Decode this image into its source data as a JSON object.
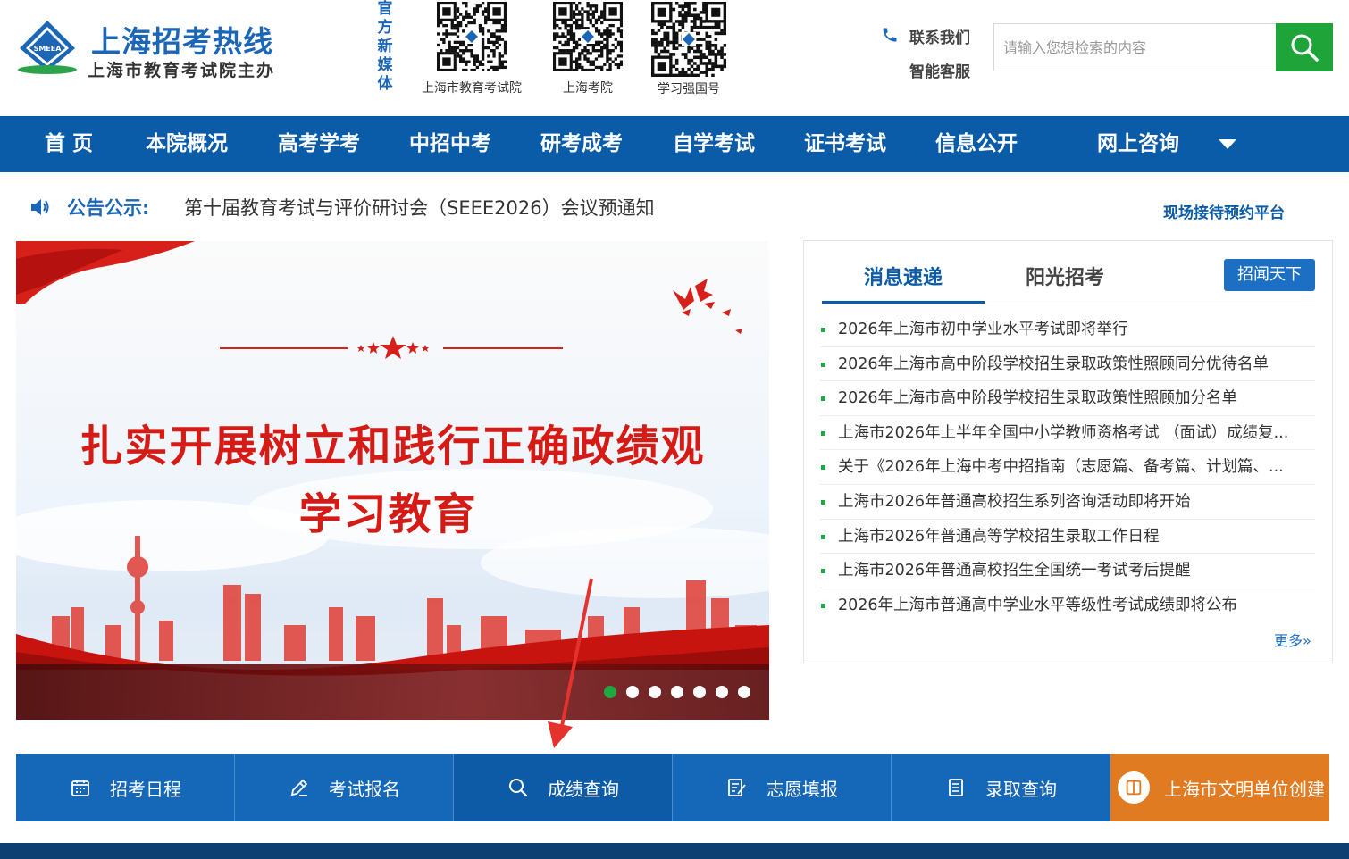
{
  "header": {
    "logo_badge": "SMEEA",
    "logo_title": "上海招考热线",
    "logo_subtitle": "上海市教育考试院主办",
    "media_label": "官方新媒体",
    "qr_codes": [
      {
        "caption": "上海市教育考试院"
      },
      {
        "caption": "上海考院"
      },
      {
        "caption": "学习强国号"
      }
    ],
    "contact_label": "联系我们",
    "service_label": "智能客服",
    "search_placeholder": "请输入您想检索的内容"
  },
  "nav": {
    "items": [
      "首 页",
      "本院概况",
      "高考学考",
      "中招中考",
      "研考成考",
      "自学考试",
      "证书考试",
      "信息公开",
      "网上咨询"
    ]
  },
  "notice": {
    "label": "公告公示:",
    "text": "第十届教育考试与评价研讨会（SEEE2026）会议预通知",
    "booking_link": "现场接待预约平台"
  },
  "banner": {
    "headline_1": "扎实开展树立和践行正确政绩观",
    "headline_2": "学习教育",
    "slide_count": 7,
    "active_slide": 1
  },
  "news": {
    "tabs": [
      "消息速递",
      "阳光招考"
    ],
    "active_tab": "消息速递",
    "button": "招闻天下",
    "items": [
      "2026年上海市初中学业水平考试即将举行",
      "2026年上海市高中阶段学校招生录取政策性照顾同分优待名单",
      "2026年上海市高中阶段学校招生录取政策性照顾加分名单",
      "上海市2026年上半年全国中小学教师资格考试 （面试）成绩复...",
      "关于《2026年上海中考中招指南（志愿篇、备考篇、计划篇、...",
      "上海市2026年普通高校招生系列咨询活动即将开始",
      "上海市2026年普通高等学校招生录取工作日程",
      "上海市2026年普通高校招生全国统一考试考后提醒",
      "2026年上海市普通高中学业水平等级性考试成绩即将公布"
    ],
    "more": "更多»"
  },
  "quick": {
    "items": [
      "招考日程",
      "考试报名",
      "成绩查询",
      "志愿填报",
      "录取查询",
      "上海市文明单位创建"
    ]
  },
  "colors": {
    "brand_blue": "#0a5ba8",
    "accent_green": "#22a543",
    "banner_red": "#d51b16",
    "orange": "#e07b22"
  }
}
